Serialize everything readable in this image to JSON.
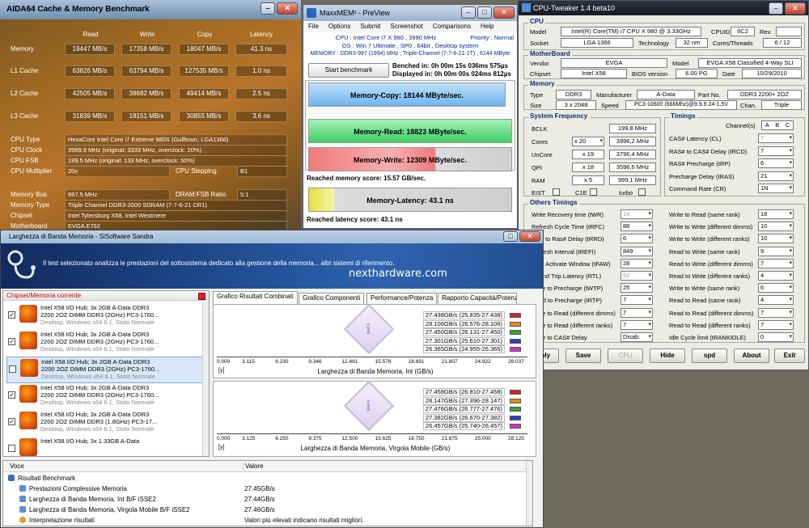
{
  "aida": {
    "title": "AIDA64 Cache & Memory Benchmark",
    "cols": [
      "Read",
      "Write",
      "Copy",
      "Latency"
    ],
    "rows": [
      {
        "label": "Memory",
        "read": "19447 MB/s",
        "write": "17358 MB/s",
        "copy": "18047 MB/s",
        "latency": "41.3 ns"
      },
      {
        "label": "L1 Cache",
        "read": "63826 MB/s",
        "write": "63794 MB/s",
        "copy": "127535 MB/s",
        "latency": "1.0 ns"
      },
      {
        "label": "L2 Cache",
        "read": "42505 MB/s",
        "write": "38682 MB/s",
        "copy": "49414 MB/s",
        "latency": "2.5 ns"
      },
      {
        "label": "L3 Cache",
        "read": "31839 MB/s",
        "write": "18151 MB/s",
        "copy": "30855 MB/s",
        "latency": "3.6 ns"
      }
    ],
    "cpu_type_label": "CPU Type",
    "cpu_type": "HexaCore Intel Core i7 Extreme 980X  (Gulftown, LGA1366)",
    "cpu_clock_label": "CPU Clock",
    "cpu_clock": "3989.9 MHz  (original: 3333 MHz, overclock: 20%)",
    "cpu_fsb_label": "CPU FSB",
    "cpu_fsb": "199.5 MHz  (original: 133 MHz, overclock: 50%)",
    "cpu_mult_label": "CPU Multiplier",
    "cpu_mult": "20x",
    "cpu_step_label": "CPU Stepping",
    "cpu_step": "B1",
    "mem_bus_label": "Memory Bus",
    "mem_bus": "997.5 MHz",
    "dram_fsb_label": "DRAM:FSB Ratio",
    "dram_fsb": "5:1",
    "mem_type_label": "Memory Type",
    "mem_type": "Triple Channel DDR3-2000 SDRAM  (7-7-6-21 CR1)",
    "chipset_label": "Chipset",
    "chipset": "Intel Tylersburg X58, Intel Westmere",
    "mobo_label": "Motherboard",
    "mobo": "EVGA E762"
  },
  "maxx": {
    "title": "MaxxMEM² - PreView",
    "menu": [
      "File",
      "Options",
      "Submit",
      "Screenshot",
      "Comparisons",
      "Help"
    ],
    "cpu_line": "CPU : Intel Core i7 X 980 , 3990 MHz",
    "priority": "Priority : Normal",
    "os_line": "OS : Win 7 Ultimate , SP0 , 64bit , Desktop system",
    "mem_line": "MEMORY : DDR3-997 (1994) MHz , Triple-Channel (7-7-6-21-1T) , 6144 MByte",
    "start": "Start benchmark",
    "benched": "Benched in: 0h 00m 15s 036ms 575µs",
    "displayed": "Displayed in: 0h 00m 00s 024ms 812µs",
    "copy": "Memory-Copy: 18144 MByte/sec.",
    "read": "Memory-Read: 18823 MByte/sec.",
    "write": "Memory-Write: 12309 MByte/sec.",
    "score": "Reached memory score: 15.57 GB/sec.",
    "latency": "Memory-Latency: 43.1 ns",
    "lat_score": "Reached latency score: 43.1 ns",
    "colors": {
      "copy": "#6fb4ee",
      "read": "#3fcf62",
      "write": "#f07a7a",
      "latency": "#e8e03a"
    }
  },
  "cput": {
    "title": "CPU-Tweaker 1.4 beta10",
    "cpu_group": "CPU",
    "model_label": "Model",
    "model": "Intel(R) Core(TM) i7 CPU     X 980  @ 3.33GHz",
    "cpuid_label": "CPUID",
    "cpuid": "6C2",
    "rev_label": "Rev.",
    "rev": "",
    "socket_label": "Socket",
    "socket": "LGA 1366",
    "tech_label": "Technology",
    "tech": "32 nm",
    "cores_label": "Cores/Threads",
    "cores": "6 / 12",
    "mobo_group": "MotherBoard",
    "vendor_label": "Vendor",
    "vendor": "EVGA",
    "mmodel_label": "Model",
    "mmodel": "EVGA X58 Classified 4-Way SLI",
    "chipset_label": "Chipset",
    "chipset": "Intel X58",
    "bios_label": "BIOS version",
    "bios": "6.00 PG",
    "date_label": "Date",
    "date": "10/29/2010",
    "mem_group": "Memory",
    "type_label": "Type",
    "type": "DDR3",
    "manu_label": "Manufacturer",
    "manu": "A-Data",
    "part_label": "Part No.",
    "part": "DDR3 2200+ 2OZ",
    "size_label": "Size",
    "size": "3 x 2048",
    "speed_label": "Speed",
    "speed": "PC3-10600 (666Mhz)@9.9.9.24-1,5V",
    "chan_label": "Chan.",
    "chan": "Triple",
    "freq_group": "System Frequency",
    "bclk_label": "BCLK",
    "bclk": "199,8 MHz",
    "cores_f_label": "Cores",
    "cores_mult": "x 20",
    "cores_f": "3996,2 MHz",
    "uncore_label": "UnCore",
    "uncore_mult": "x 19",
    "uncore_f": "3796,4 MHz",
    "qpi_label": "QPI",
    "qpi_mult": "x 18",
    "qpi_f": "3596,6 MHz",
    "ram_label": "RAM",
    "ram_mult": "x 5",
    "ram_f": "999,1 MHz",
    "eist": "EIST",
    "c1e": "C1E",
    "turbo": "turbo",
    "tim_group": "Timings",
    "channels_label": "Channel(s)",
    "ch_a": "A",
    "ch_b": "B",
    "ch_c": "C",
    "timings": [
      {
        "label": "CAS# Latency (CL)",
        "value": "7",
        "dis": true
      },
      {
        "label": "RAS# to CAS# Delay (tRCD)",
        "value": "7",
        "dis": false
      },
      {
        "label": "RAS# Precharge (tRP)",
        "value": "6",
        "dis": false
      },
      {
        "label": "Precharge Delay (tRAS)",
        "value": "21",
        "dis": false
      },
      {
        "label": "Command Rate (CR)",
        "value": "1N",
        "dis": false
      }
    ],
    "other_group": "Others Timings",
    "other_left": [
      {
        "label": "Write Recovery time (tWR)",
        "value": "14",
        "dis": true
      },
      {
        "label": "Refresh Cycle Time (tRFC)",
        "value": "88",
        "dis": false
      },
      {
        "label": "Row to Ras# Delay (tRRD)",
        "value": "6",
        "dis": false
      },
      {
        "label": "Refresh Interval (tREFI)",
        "value": "849",
        "dis": false
      },
      {
        "label": "Four Activate Window (tFAW)",
        "value": "28",
        "dis": false
      },
      {
        "label": "Round Trip Latency (RTL)",
        "value": "53",
        "dis": true
      },
      {
        "label": "Write to Precharge (tWTP)",
        "value": "25",
        "dis": false
      },
      {
        "label": "Read to Precharge (tRTP)",
        "value": "7",
        "dis": false
      },
      {
        "label": "Write to Read (different dimms)",
        "value": "7",
        "dis": false
      },
      {
        "label": "Write to Read (different ranks)",
        "value": "7",
        "dis": false
      },
      {
        "label": "Write to CAS# Delay",
        "value": "Disab.",
        "dis": false
      }
    ],
    "other_right": [
      {
        "label": "Write to Read (same rank)",
        "value": "18"
      },
      {
        "label": "Write to Write (different dimms)",
        "value": "10"
      },
      {
        "label": "Write to Write (different ranks)",
        "value": "10"
      },
      {
        "label": "Read to Write (same rank)",
        "value": "9"
      },
      {
        "label": "Read to Write (different dimms)",
        "value": "7"
      },
      {
        "label": "Read to Write (different ranks)",
        "value": "4"
      },
      {
        "label": "Write to Write (same rank)",
        "value": "6"
      },
      {
        "label": "Read to Read (same rank)",
        "value": "4"
      },
      {
        "label": "Read to Read (different dimms)",
        "value": "7"
      },
      {
        "label": "Read to Read (different ranks)",
        "value": "7"
      },
      {
        "label": "Idle Cycle limit (tRANKIDLE)",
        "value": "0"
      }
    ],
    "buttons": [
      "Apply",
      "Save",
      "CPU",
      "Hide",
      "spd",
      "About",
      "Exit"
    ]
  },
  "sandra": {
    "title": "Larghezza di Banda Memoria - SiSoftware Sandra",
    "banner": "Il test selezionato analizza le prestazioni del sottosistema dedicato alla gestione della memoria... altri sistemi di riferimento.",
    "watermark": "nexthardware.com",
    "chipset_header": "Chipset/Memoria corrente",
    "items": [
      {
        "checked": true,
        "line1": "Intel X58 I/O Hub; 3x 2GB A-Data DDR3",
        "line2": "2200 2OZ DIMM DDR3 (2GHz) PC3-1760...",
        "line3": "Desktop, Windows x64 6.1, Stato Normale"
      },
      {
        "checked": true,
        "line1": "Intel X58 I/O Hub; 3x 2GB A-Data DDR3",
        "line2": "2200 2OZ DIMM DDR3 (2GHz) PC3-1760...",
        "line3": "Desktop, Windows x64 6.1, Stato Normale"
      },
      {
        "checked": false,
        "line1": "Intel X58 I/O Hub; 3x 2GB A-Data DDR3",
        "line2": "2200 2OZ DIMM DDR3 (2GHz) PC3-1760...",
        "line3": "Desktop, Windows x64 6.1, Stato Normale"
      },
      {
        "checked": true,
        "line1": "Intel X58 I/O Hub; 3x 2GB A-Data DDR3",
        "line2": "2200 2OZ DIMM DDR3 (2GHz) PC3-1760...",
        "line3": "Desktop, Windows x64 6.1, Stato Normale"
      },
      {
        "checked": true,
        "line1": "Intel X58 I/O Hub; 3x 2GB A-Data DDR3",
        "line2": "2200 2OZ DIMM DDR3 (1.8GHz) PC3-17...",
        "line3": "Desktop, Windows x64 6.1, Stato Normale"
      },
      {
        "checked": false,
        "line1": "Intel X58 I/O Hub; 3x 1.33GB A-Data",
        "line2": "",
        "line3": ""
      }
    ],
    "tabs": [
      "Grafico Risultati Combinati",
      "Grafico Componenti",
      "Performance/Potenza",
      "Rapporto Capacità/Potenza"
    ],
    "y_tag": "[y]",
    "table_headers": {
      "voce": "Voce",
      "valore": "Valore"
    },
    "results_group": "Risultati Benchmark",
    "results": [
      {
        "voce": "Prestazioni Complessive Memoria",
        "valore": "27.45GB/s"
      },
      {
        "voce": "Larghezza di Banda Memoria, Int B/F iSSE2",
        "valore": "27.44GB/s"
      },
      {
        "voce": "Larghezza di Banda Memoria, Virgola Mobile B/F iSSE2",
        "valore": "27.46GB/s"
      },
      {
        "voce": "Interpretazione risultati",
        "valore": "Valori più elevati indicano risultati migliori."
      }
    ]
  },
  "chart_data": [
    {
      "type": "bar",
      "xlabel": "Larghezza di Banda Memoria, Int (GB/s)",
      "xticks": [
        "0.000",
        "3.115",
        "6.230",
        "9.346",
        "12.461",
        "15.576",
        "18.691",
        "21.807",
        "24.922",
        "28.037"
      ],
      "series": [
        {
          "label": "27.438GB/s (25.835-27.438)",
          "value": 27.438,
          "color": "#d62424"
        },
        {
          "label": "28.106GB/s (26.576-28.106)",
          "value": 28.106,
          "color": "#e88a1a"
        },
        {
          "label": "27.450GB/s (26.131-27.450)",
          "value": 27.45,
          "color": "#2ea52e"
        },
        {
          "label": "27.301GB/s (25.610-27.301)",
          "value": 27.301,
          "color": "#2a3fc4"
        },
        {
          "label": "26.365GB/s (24.955-26.365)",
          "value": 26.365,
          "color": "#c636c6"
        }
      ]
    },
    {
      "type": "bar",
      "xlabel": "Larghezza di Banda Memoria, Virgola Mobile (GB/s)",
      "xticks": [
        "0.000",
        "3.125",
        "6.250",
        "9.375",
        "12.500",
        "15.625",
        "18.750",
        "21.875",
        "25.000",
        "28.125"
      ],
      "series": [
        {
          "label": "27.458GB/s (26.810-27.458)",
          "value": 27.458,
          "color": "#d62424"
        },
        {
          "label": "28.147GB/s (27.396-28.147)",
          "value": 28.147,
          "color": "#e88a1a"
        },
        {
          "label": "27.476GB/s (26.777-27.476)",
          "value": 27.476,
          "color": "#2ea52e"
        },
        {
          "label": "27.382GB/s (26.670-27.382)",
          "value": 27.382,
          "color": "#2a3fc4"
        },
        {
          "label": "26.457GB/s (25.740-26.457)",
          "value": 26.457,
          "color": "#c636c6"
        }
      ]
    }
  ]
}
